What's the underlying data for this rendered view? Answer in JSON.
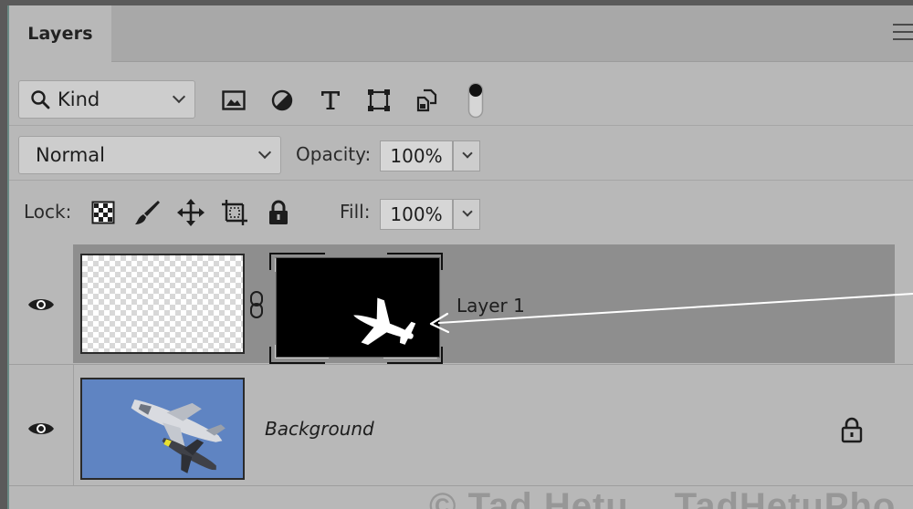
{
  "panel": {
    "tab_label": "Layers"
  },
  "filter": {
    "kind_label": "Kind",
    "icons": [
      "image-filter-icon",
      "adjustment-filter-icon",
      "type-filter-icon",
      "shape-filter-icon",
      "smart-object-filter-icon",
      "filter-toggle-icon"
    ]
  },
  "blend": {
    "mode": "Normal",
    "opacity_label": "Opacity:",
    "opacity_value": "100%"
  },
  "lock": {
    "label": "Lock:",
    "icons": [
      "lock-transparent-pixels-icon",
      "lock-image-pixels-icon",
      "lock-position-icon",
      "lock-artboard-icon",
      "lock-all-icon"
    ],
    "fill_label": "Fill:",
    "fill_value": "100%"
  },
  "layers": [
    {
      "name": "Layer 1",
      "visible": true,
      "has_mask": true,
      "mask_icon": "airplane-silhouette-icon"
    },
    {
      "name": "Background",
      "visible": true,
      "locked": true
    }
  ],
  "watermark": {
    "left": "© Tad Hetu",
    "right": "TadHetuPho"
  },
  "colors": {
    "panel_bg": "#b8b8b8",
    "selected_layer_bg": "#8e8e8e",
    "sky_blue": "#5f84c2"
  }
}
